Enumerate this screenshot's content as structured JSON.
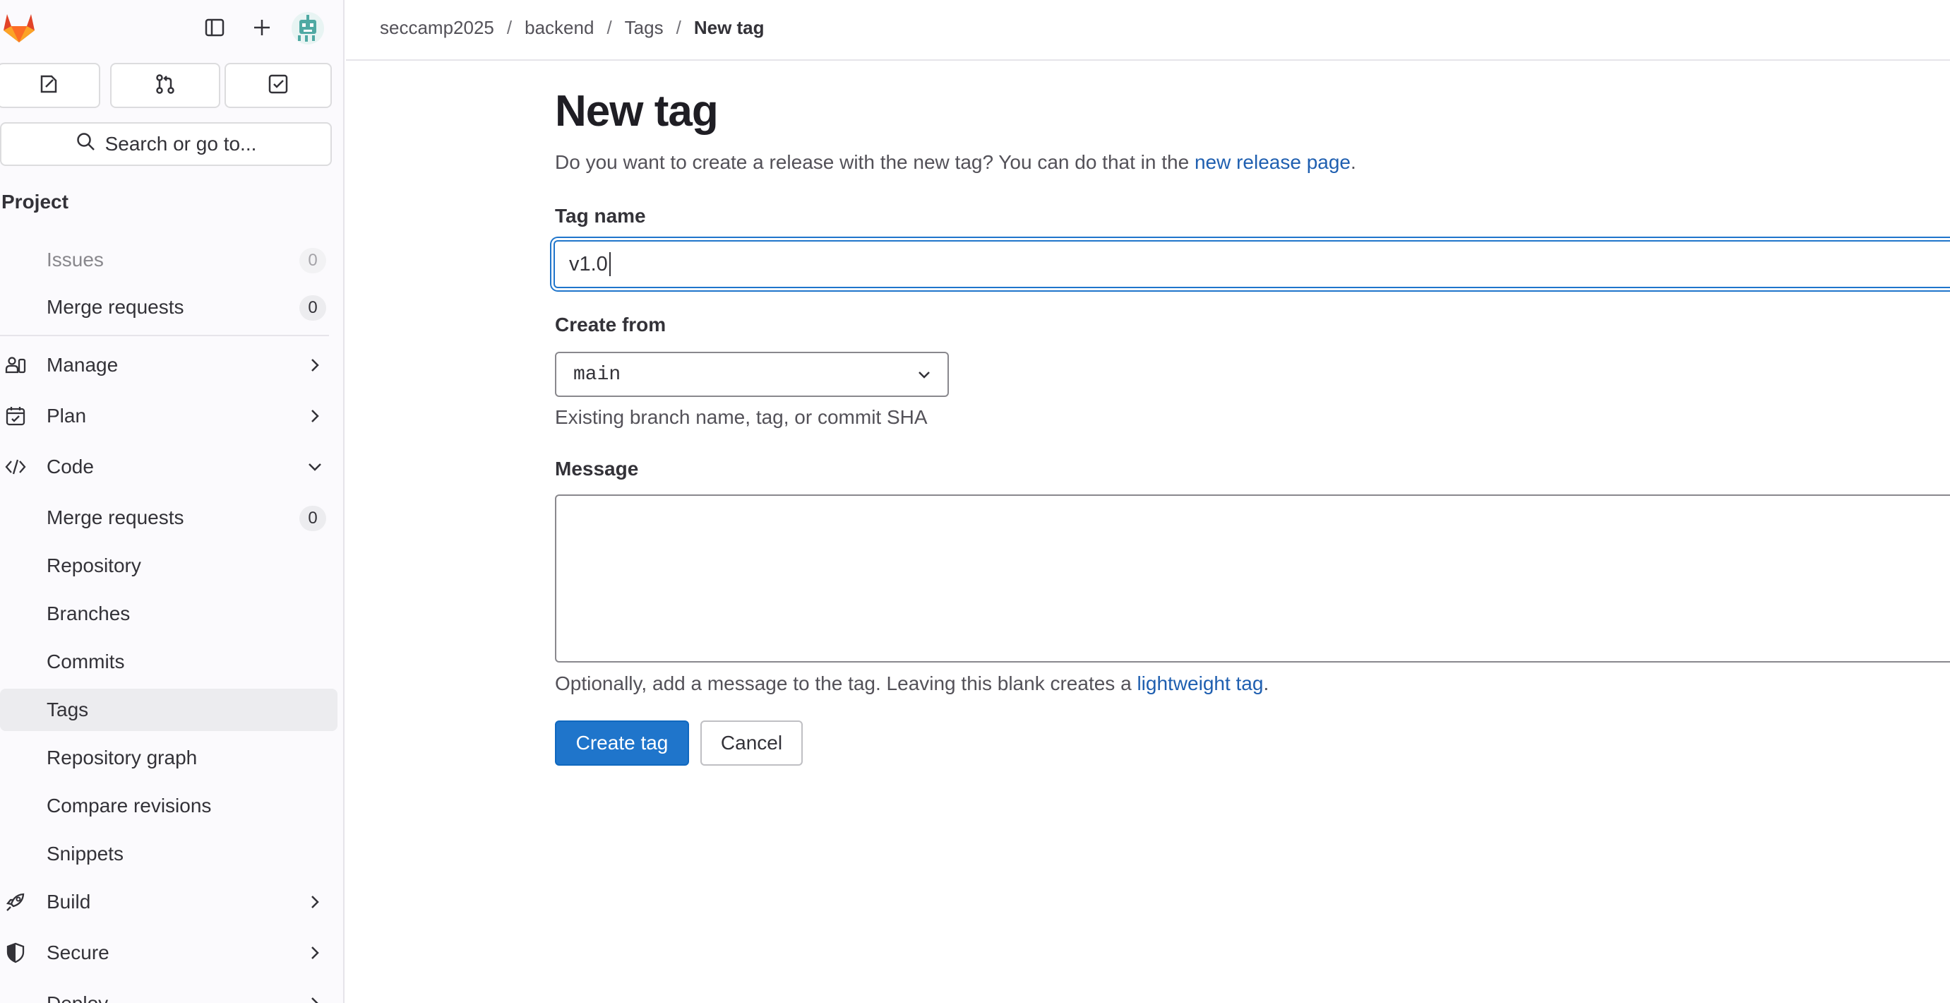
{
  "sidebar": {
    "search_label": "Search or go to...",
    "section_title": "Project",
    "top_items": [
      {
        "label": "Issues",
        "count": "0"
      },
      {
        "label": "Merge requests",
        "count": "0"
      }
    ],
    "groups": {
      "manage": "Manage",
      "plan": "Plan",
      "code": "Code",
      "build": "Build",
      "secure": "Secure",
      "deploy": "Deploy"
    },
    "code_items": [
      {
        "label": "Merge requests",
        "count": "0"
      },
      {
        "label": "Repository"
      },
      {
        "label": "Branches"
      },
      {
        "label": "Commits"
      },
      {
        "label": "Tags"
      },
      {
        "label": "Repository graph"
      },
      {
        "label": "Compare revisions"
      },
      {
        "label": "Snippets"
      }
    ]
  },
  "breadcrumb": [
    "seccamp2025",
    "backend",
    "Tags",
    "New tag"
  ],
  "page": {
    "title": "New tag",
    "intro_text": "Do you want to create a release with the new tag? You can do that in the ",
    "intro_link": "new release page",
    "intro_end": "."
  },
  "form": {
    "tag_name_label": "Tag name",
    "tag_name_value": "v1.0",
    "create_from_label": "Create from",
    "create_from_value": "main",
    "create_from_help": "Existing branch name, tag, or commit SHA",
    "message_label": "Message",
    "message_value": "",
    "message_help_text": "Optionally, add a message to the tag. Leaving this blank creates a ",
    "message_help_link": "lightweight tag",
    "message_help_end": ".",
    "submit_label": "Create tag",
    "cancel_label": "Cancel"
  },
  "colors": {
    "primary": "#1f75cb",
    "link": "#1f5fb0",
    "active_nav": "#ececef"
  },
  "icons": [
    "gitlab-logo-icon",
    "sidebar-toggle-icon",
    "plus-icon",
    "avatar-icon",
    "issues-icon",
    "merge-request-icon",
    "todo-icon",
    "search-icon",
    "users-icon",
    "calendar-icon",
    "code-icon",
    "rocket-icon",
    "shield-icon",
    "chevron-right-icon",
    "chevron-down-icon"
  ]
}
